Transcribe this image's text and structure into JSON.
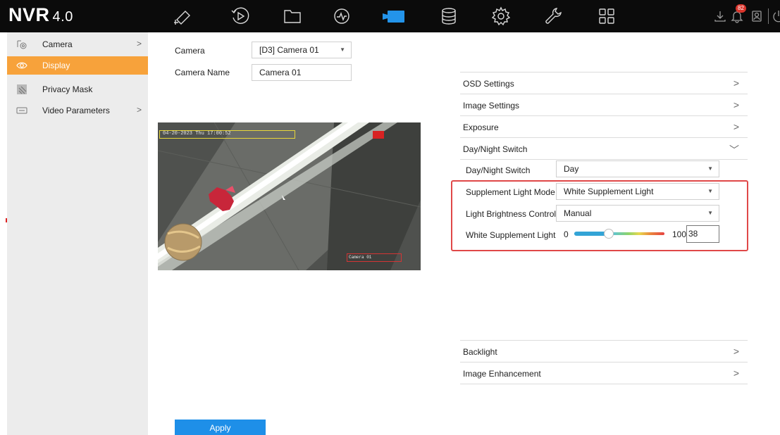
{
  "app": {
    "logo": "NVR",
    "version": "4.0"
  },
  "toolbar": {
    "icons": [
      "live-view-icon",
      "playback-icon",
      "file-management-icon",
      "smart-analysis-icon",
      "camera-icon",
      "storage-icon",
      "system-settings-icon",
      "maintenance-icon",
      "grid-layout-icon"
    ],
    "active": "camera-icon",
    "tray": {
      "alarm_count": "82"
    },
    "accent": "#1e8fe8"
  },
  "sidebar": {
    "items": [
      {
        "label": "Camera",
        "icon": "camera-settings-icon",
        "chevron": ">"
      },
      {
        "label": "Display",
        "icon": "display-eye-icon",
        "selected": true
      },
      {
        "label": "Privacy Mask",
        "icon": "privacy-mask-icon"
      },
      {
        "label": "Video Parameters",
        "icon": "video-parameters-icon",
        "chevron": ">"
      }
    ],
    "selected_color": "#f7a23b"
  },
  "form": {
    "camera_label": "Camera",
    "camera_value": "[D3] Camera 01",
    "camera_name_label": "Camera Name",
    "camera_name_value": "Camera 01"
  },
  "preview": {
    "osd_time": "04-20-2023 Thu 17:00:52",
    "osd_name": "Camera 01"
  },
  "settings": {
    "osd": {
      "label": "OSD Settings",
      "chevron": ">"
    },
    "image": {
      "label": "Image Settings",
      "chevron": ">"
    },
    "exposure": {
      "label": "Exposure",
      "chevron": ">"
    },
    "daynight": {
      "label": "Day/Night Switch",
      "chevron": "﹀"
    },
    "daynight_switch": {
      "label": "Day/Night Switch",
      "value": "Day"
    },
    "supplement_mode": {
      "label": "Supplement Light Mode",
      "value": "White Supplement Light"
    },
    "brightness_control": {
      "label": "Light Brightness Control",
      "value": "Manual"
    },
    "white_light": {
      "label": "White Supplement Light",
      "min": "0",
      "max": "100",
      "value": "38"
    },
    "backlight": {
      "label": "Backlight",
      "chevron": ">"
    },
    "enhancement": {
      "label": "Image Enhancement",
      "chevron": ">"
    },
    "highlight_color": "#e04848"
  },
  "apply_label": "Apply"
}
